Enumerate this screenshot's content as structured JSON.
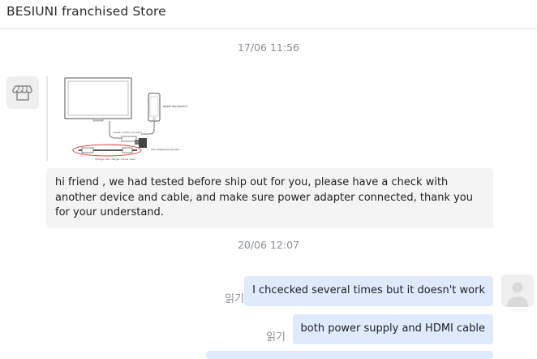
{
  "header": {
    "title": "BESIUNI franchised Store"
  },
  "timestamps": [
    "17/06 11:56",
    "20/06 12:07"
  ],
  "messages": {
    "incoming_text": "hi friend ,  we had tested before ship out for you, please have a check with another device and cable, and make sure power adapter connected, thank you for your understand.",
    "outgoing": [
      {
        "text": "I chcecked several times but it doesn't work",
        "status": "읽기"
      },
      {
        "text": "both power supply and HDMI cable",
        "status": "읽기"
      }
    ]
  },
  "image_labels": {
    "phone": "Apple equipment",
    "cable1": "Cable 1 (from yourself)",
    "adapter": "this adapter/equipment",
    "charger": "Charger (No charger not be used)"
  },
  "colors": {
    "incoming_bubble": "#f4f4f5",
    "outgoing_bubble": "#dfeaff",
    "timestamp": "#8a8f98"
  },
  "icons": {
    "store_avatar": "store-icon",
    "user_avatar": "user-silhouette-icon"
  }
}
